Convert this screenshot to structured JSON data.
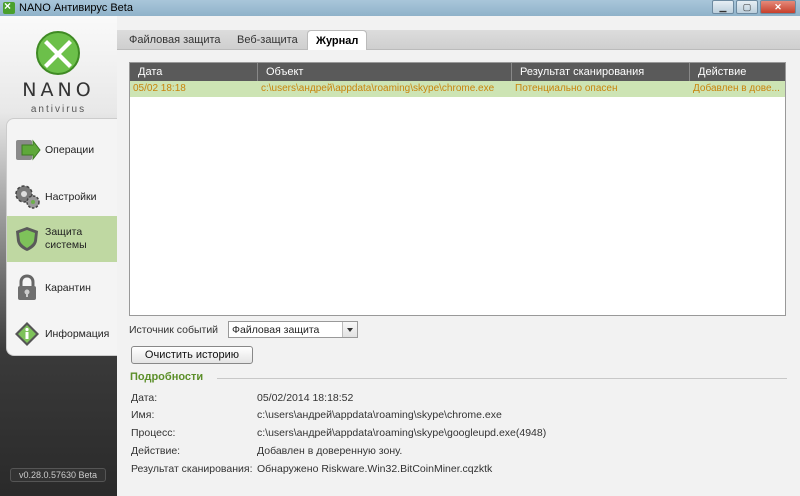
{
  "window": {
    "title": "NANO Антивирус Beta",
    "controls": [
      "minimize",
      "maximize",
      "close"
    ]
  },
  "logo": {
    "brand": "NANO",
    "sub": "antivirus"
  },
  "sidebar": {
    "items": [
      {
        "label_line1": "Операции",
        "label_line2": "",
        "icon": "arrow-icon",
        "active": false
      },
      {
        "label_line1": "Настройки",
        "label_line2": "",
        "icon": "gears-icon",
        "active": false
      },
      {
        "label_line1": "Защита",
        "label_line2": "системы",
        "icon": "shield-icon",
        "active": true
      },
      {
        "label_line1": "Карантин",
        "label_line2": "",
        "icon": "lock-icon",
        "active": false
      },
      {
        "label_line1": "Информация",
        "label_line2": "",
        "icon": "info-icon",
        "active": false
      }
    ],
    "version": "v0.28.0.57630 Beta"
  },
  "tabs": [
    {
      "label": "Файловая защита",
      "active": false
    },
    {
      "label": "Веб-защита",
      "active": false
    },
    {
      "label": "Журнал",
      "active": true
    }
  ],
  "table": {
    "headers": [
      "Дата",
      "Объект",
      "Результат сканирования",
      "Действие"
    ],
    "rows": [
      [
        "05/02 18:18",
        "c:\\users\\андрей\\appdata\\roaming\\skype\\chrome.exe",
        "Потенциально опасен",
        "Добавлен в дове..."
      ]
    ]
  },
  "filter": {
    "label": "Источник событий",
    "value": "Файловая защита"
  },
  "clear_button": "Очистить историю",
  "details": {
    "title": "Подробности",
    "fields": [
      {
        "label": "Дата:",
        "value": "05/02/2014 18:18:52"
      },
      {
        "label": "Имя:",
        "value": "c:\\users\\андрей\\appdata\\roaming\\skype\\chrome.exe"
      },
      {
        "label": "Процесс:",
        "value": "c:\\users\\андрей\\appdata\\roaming\\skype\\googleupd.exe(4948)"
      },
      {
        "label": "Действие:",
        "value": "Добавлен в доверенную зону."
      },
      {
        "label": "Результат сканирования:",
        "value": "Обнаружено Riskware.Win32.BitCoinMiner.cqzktk"
      }
    ]
  },
  "colors": {
    "accent_green": "#5c8f2a",
    "selected_row": "#cde4b4",
    "row_text": "#c8840c",
    "header_bg": "#5a5a5a"
  }
}
